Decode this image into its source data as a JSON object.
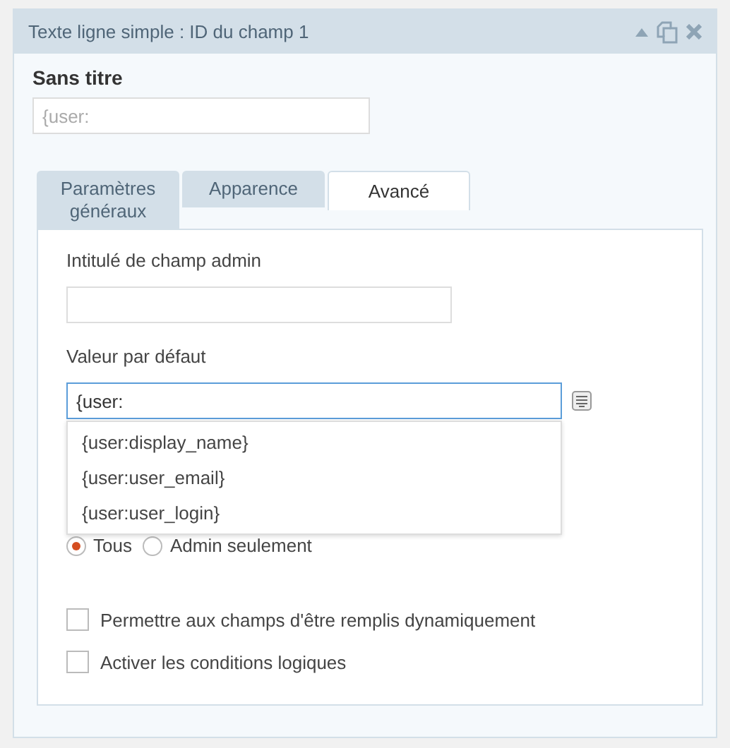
{
  "panel": {
    "title": "Texte ligne simple : ID du champ 1"
  },
  "field_label": "Sans titre",
  "preview_field": {
    "placeholder": "{user:"
  },
  "tabs": [
    {
      "label": "Paramètres généraux",
      "selected": false
    },
    {
      "label": "Apparence",
      "selected": false
    },
    {
      "label": "Avancé",
      "selected": true
    }
  ],
  "admin_label": {
    "label": "Intitulé de champ admin"
  },
  "default_value": {
    "label": "Valeur par défaut",
    "value": "{user:",
    "suggestions": [
      "{user:display_name}",
      "{user:user_email}",
      "{user:user_login}"
    ]
  },
  "visibility": [
    {
      "label": "Tous",
      "selected": true
    },
    {
      "label": "Admin seulement",
      "selected": false
    }
  ],
  "options": [
    {
      "label": "Permettre aux champs d'être remplis dynamiquement",
      "checked": false
    },
    {
      "label": "Activer les conditions logiques",
      "checked": false
    }
  ]
}
